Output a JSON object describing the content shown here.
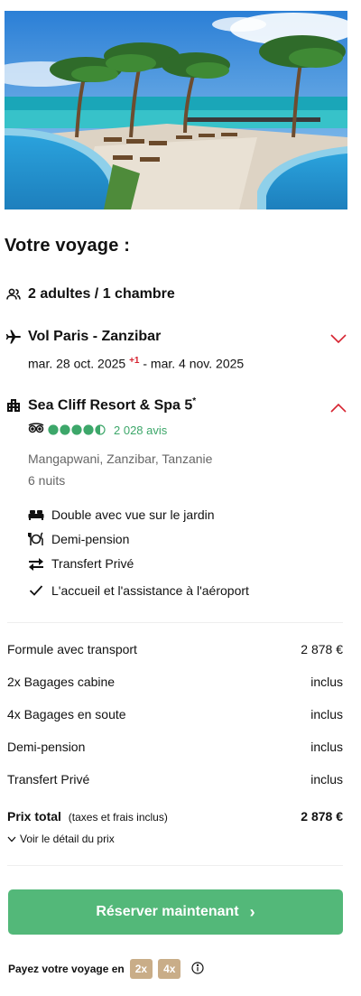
{
  "title": "Votre voyage :",
  "travellers": "2 adultes / 1 chambre",
  "flight": {
    "label": "Vol Paris - Zanzibar",
    "depart": "mar. 28 oct. 2025",
    "plus": "+1",
    "return": "- mar. 4 nov. 2025"
  },
  "hotel": {
    "name": "Sea Cliff Resort & Spa 5",
    "star": "*",
    "reviews": "2 028 avis",
    "rating_score": 4.5,
    "rating_max": 5,
    "location": "Mangapwani, Zanzibar, Tanzanie",
    "nights": "6 nuits"
  },
  "amenities": [
    {
      "icon": "bed-icon",
      "label": "Double avec vue sur le jardin"
    },
    {
      "icon": "dining-icon",
      "label": "Demi-pension"
    },
    {
      "icon": "transfer-icon",
      "label": "Transfert Privé"
    },
    {
      "icon": "check-icon",
      "label": "L'accueil et l'assistance à l'aéroport"
    }
  ],
  "prices": [
    {
      "label": "Formule avec transport",
      "value": "2 878 €"
    },
    {
      "label": "2x Bagages cabine",
      "value": "inclus"
    },
    {
      "label": "4x Bagages en soute",
      "value": "inclus"
    },
    {
      "label": "Demi-pension",
      "value": "inclus"
    },
    {
      "label": "Transfert Privé",
      "value": "inclus"
    }
  ],
  "total": {
    "label": "Prix total",
    "sub": "(taxes et frais inclus)",
    "value": "2 878 €",
    "detail_link": "Voir le détail du prix"
  },
  "cta": {
    "label": "Réserver maintenant",
    "arrow": "›"
  },
  "payment": {
    "label": "Payez votre voyage en",
    "options": [
      "2x",
      "4x"
    ]
  },
  "colors": {
    "accent_green": "#53b879",
    "chevron_red": "#d6222f",
    "pill": "#c9ad88",
    "rating_green": "#3da76a"
  }
}
